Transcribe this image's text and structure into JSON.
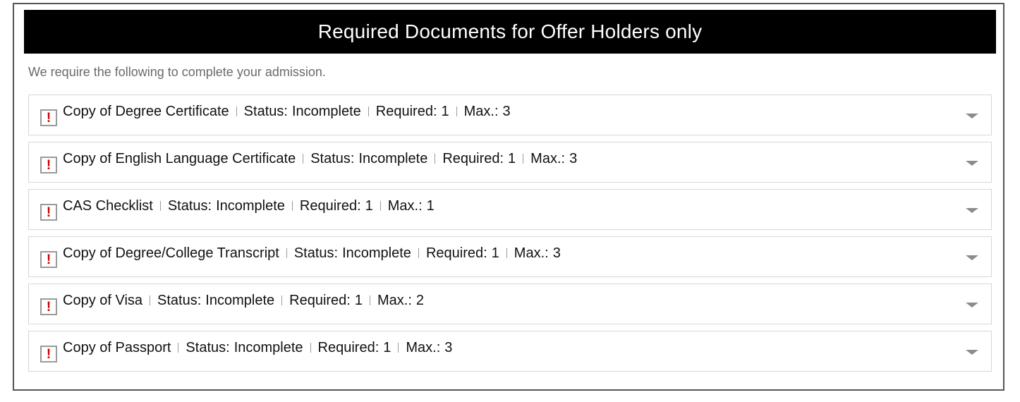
{
  "header": {
    "title": "Required Documents for Offer Holders only"
  },
  "intro": "We require the following to complete your admission.",
  "labels": {
    "status": "Status:",
    "required": "Required:",
    "max": "Max.:"
  },
  "icons": {
    "status_icon": "exclamation-warning-icon",
    "expand_icon": "chevron-down-icon"
  },
  "colors": {
    "header_bg": "#000000",
    "warning": "#cc0000"
  },
  "documents": [
    {
      "name": "Copy of Degree Certificate",
      "status": "Incomplete",
      "required": "1",
      "max": "3"
    },
    {
      "name": "Copy of English Language Certificate",
      "status": "Incomplete",
      "required": "1",
      "max": "3"
    },
    {
      "name": "CAS Checklist",
      "status": "Incomplete",
      "required": "1",
      "max": "1"
    },
    {
      "name": "Copy of Degree/College Transcript",
      "status": "Incomplete",
      "required": "1",
      "max": "3"
    },
    {
      "name": "Copy of Visa",
      "status": "Incomplete",
      "required": "1",
      "max": "2"
    },
    {
      "name": "Copy of Passport",
      "status": "Incomplete",
      "required": "1",
      "max": "3"
    }
  ]
}
